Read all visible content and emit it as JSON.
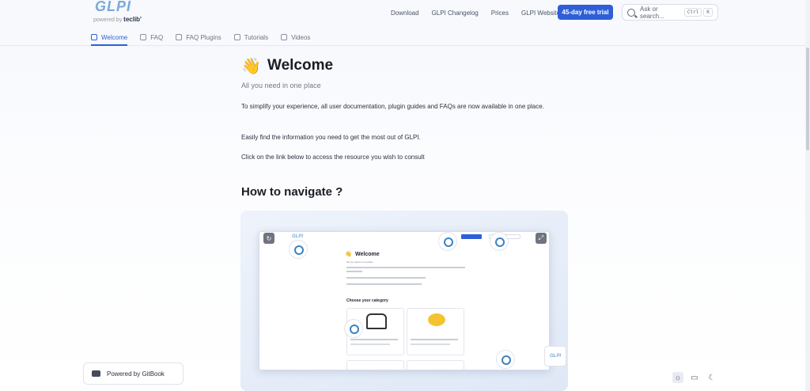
{
  "header": {
    "logo": {
      "brand": "GLPI",
      "powered": "powered by",
      "company": "teclib'"
    },
    "nav": [
      {
        "label": "Download"
      },
      {
        "label": "GLPI Changelog"
      },
      {
        "label": "Prices"
      },
      {
        "label": "GLPI Website"
      }
    ],
    "cta": "45-day free trial",
    "search": {
      "placeholder": "Ask or search...",
      "kbd1": "Ctrl",
      "kbd2": "K"
    }
  },
  "tabs": [
    {
      "label": "Welcome",
      "icon": "home-icon",
      "active": true
    },
    {
      "label": "FAQ",
      "icon": "faq-icon"
    },
    {
      "label": "FAQ Plugins",
      "icon": "eye-icon"
    },
    {
      "label": "Tutorials",
      "icon": "book-icon"
    },
    {
      "label": "Videos",
      "icon": "video-icon"
    }
  ],
  "main": {
    "emoji": "👋",
    "title": "Welcome",
    "subtitle": "All you need in one place",
    "p1": "To simplify your experience, all user documentation, plugin guides and FAQs are now available in one place.",
    "p2": "Easily find the information you need to get the most out of GLPI.",
    "p3": "Click on the link below to access the resource you wish to consult",
    "h2": "How to navigate ?"
  },
  "video": {
    "inner_title": "Welcome",
    "inner_subtitle": "All you need in one place",
    "inner_h2": "Choose your category",
    "badge": "GLPI"
  },
  "footer": {
    "gitbook": "Powered by GitBook"
  },
  "colors": {
    "accent": "#2f5fd8",
    "logo": "#7aa9da"
  }
}
